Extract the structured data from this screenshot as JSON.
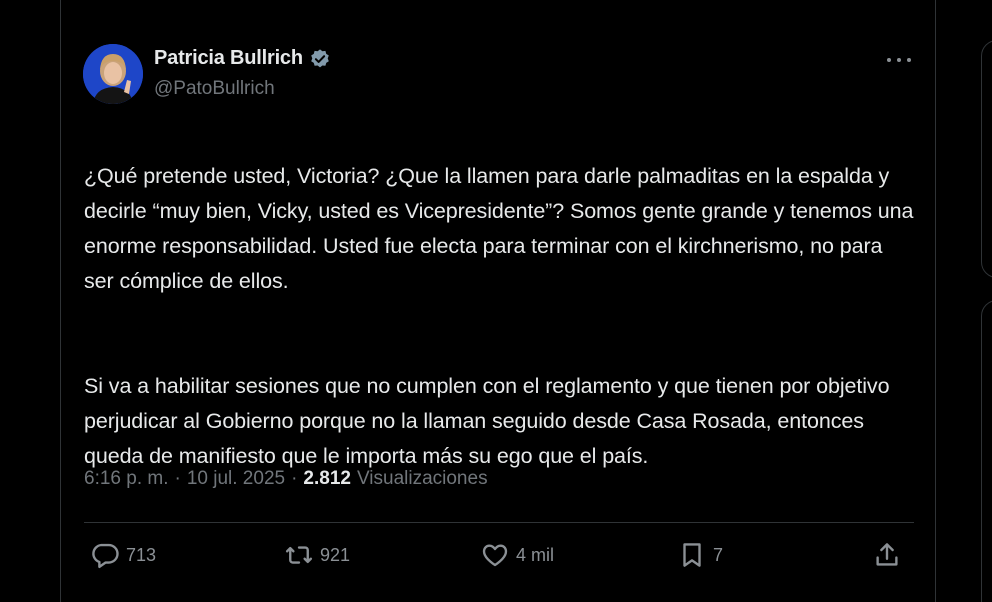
{
  "colors": {
    "background": "#000000",
    "text_primary": "#e7e9ea",
    "text_secondary": "#71767b",
    "verified_badge": "#829aab",
    "border": "#2f3336"
  },
  "author": {
    "name": "Patricia Bullrich",
    "handle": "@PatoBullrich",
    "verified_icon": "verified-badge-icon",
    "avatar_icon": "avatar"
  },
  "tweet": {
    "paragraph1": "¿Qué pretende usted, Victoria? ¿Que la llamen para darle palmaditas en la espalda y decirle “muy bien, Vicky, usted es Vicepresidente”? Somos gente grande y tenemos una enorme responsabilidad. Usted fue electa para terminar con el kirchnerismo, no para ser cómplice de ellos.",
    "paragraph2": "Si va a habilitar sesiones que no cumplen con el reglamento y que tienen por objetivo perjudicar al Gobierno porque no la llaman seguido desde Casa Rosada, entonces queda de manifiesto que le importa más su ego que el país."
  },
  "meta": {
    "time": "6:16 p. m.",
    "separator1": "·",
    "date": "10 jul. 2025",
    "separator2": "·",
    "views_count": "2.812",
    "views_label": "Visualizaciones"
  },
  "actions": {
    "replies": "713",
    "reposts": "921",
    "likes": "4 mil",
    "bookmarks": "7",
    "icons": [
      "reply-icon",
      "repost-icon",
      "like-icon",
      "bookmark-icon",
      "share-icon"
    ]
  },
  "more_icon": "more-options-icon"
}
